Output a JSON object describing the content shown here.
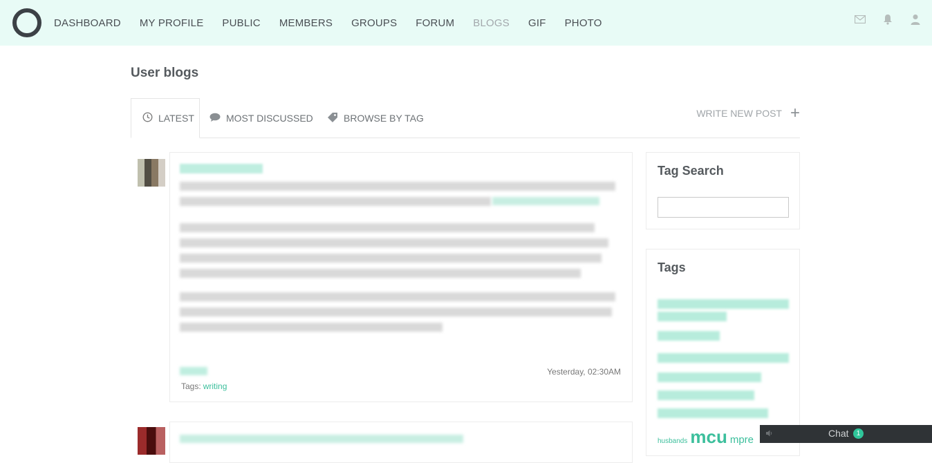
{
  "topbar": {
    "nav": [
      {
        "label": "DASHBOARD"
      },
      {
        "label": "MY PROFILE"
      },
      {
        "label": "PUBLIC"
      },
      {
        "label": "MEMBERS"
      },
      {
        "label": "GROUPS"
      },
      {
        "label": "FORUM"
      },
      {
        "label": "BLOGS",
        "active": true
      },
      {
        "label": "GIF"
      },
      {
        "label": "PHOTO"
      }
    ],
    "icons": [
      "mail-icon",
      "bell-icon",
      "user-icon"
    ]
  },
  "page": {
    "title": "User blogs"
  },
  "tabs": {
    "latest": "LATEST",
    "most_discussed": "MOST DISCUSSED",
    "browse_by_tag": "BROWSE BY TAG",
    "write_new": "WRITE NEW POST"
  },
  "post": {
    "date": "Yesterday, 02:30AM",
    "tags_label": "Tags:",
    "tag": "writing"
  },
  "sidebar": {
    "tag_search_title": "Tag Search",
    "tags_title": "Tags",
    "tag_cloud_visible": [
      "husbands",
      "mcu",
      "mpre"
    ]
  },
  "chat": {
    "label": "Chat",
    "count": "1"
  },
  "colors": {
    "accent": "#3cbf9c",
    "topbar_bg": "#e8fbf6",
    "chat_bg": "#2f3336"
  }
}
